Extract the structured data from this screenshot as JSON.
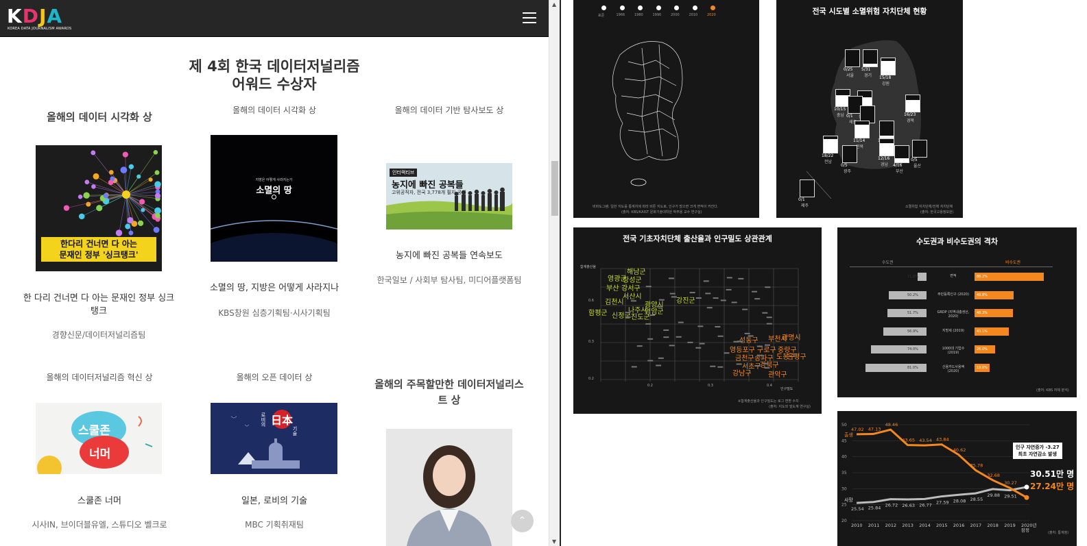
{
  "logo": {
    "letters": [
      "K",
      "D",
      "J",
      "A"
    ],
    "letter_colors": [
      "#ffffff",
      "#e8336d",
      "#f5c518",
      "#1cb5c9"
    ],
    "subtitle": "KOREA DATA JOURNALISM AWARDS"
  },
  "page": {
    "heading_line1": "제 4회 한국 데이터저널리즘",
    "heading_line2": "어워드 수상자"
  },
  "awards": [
    {
      "category": "올해의 데이터 시각화 상",
      "title": "한 다리 건너면 다 아는 문재인 정부 싱크탱크",
      "org": "경향신문/데이터저널리즘팀",
      "thumb_text_1": "한다리 건너면 다 아는",
      "thumb_text_2": "문재인 정부 '싱크탱크'"
    },
    {
      "category": "올해의 데이터 시각화 상",
      "title": "소멸의 땅, 지방은 어떻게 사라지나",
      "org": "KBS창원 심층기획팀·시사기획팀",
      "thumb_text_1": "지방은 어떻게 사라지는가",
      "thumb_text_2": "소멸의 땅"
    },
    {
      "category": "올해의 데이터 기반 탐사보도 상",
      "title": "농지에 빠진 공복들 연속보도",
      "org": "한국일보 / 사회부 탐사팀, 미디어플랫폼팀",
      "thumb_text_1": "인터랙티브",
      "thumb_text_2": "농지에 빠진 공복들",
      "thumb_text_3": "고위공직자, 전국 3,778개 필지 공개"
    },
    {
      "category": "올해의 데이터저널리즘 혁신 상",
      "title": "스쿨존 너머",
      "org": "시사IN, 브이더블유엘, 스튜디오 벨크로",
      "thumb_text_1": "스쿨존",
      "thumb_text_2": "너머"
    },
    {
      "category": "올해의 오픈 데이터 상",
      "title": "일본, 로비의 기술",
      "org": "MBC 기획취재팀",
      "thumb_text_1": "日本",
      "thumb_text_2": "로비의",
      "thumb_text_3": "기술"
    },
    {
      "category": "올해의 주목할만한 데이터저널리스트 상"
    }
  ],
  "controls": {
    "back_to_top": "⌃",
    "scroll_up": "▲",
    "scroll_down": "▼"
  },
  "panels": {
    "timeline": {
      "years": [
        "표준",
        "1966",
        "1980",
        "1990",
        "2000",
        "2010",
        "2020"
      ],
      "selected": "2020",
      "note": "비바도그램: 일반 지도를 통계치에 따라 비튼 지도로, 인구가 많으면 크게 면적이 커진다.",
      "source": "(출처: KBS/KAIST 문화기술대학원 박주용 교수 연구실)"
    },
    "regions": {
      "title": "전국 시도별 소멸위험 자치단체 현황",
      "items": [
        {
          "value": "0/25",
          "name": "서울"
        },
        {
          "value": "5/31",
          "name": "경기"
        },
        {
          "value": "15/18",
          "name": "강원"
        },
        {
          "value": "10/15",
          "name": "충남"
        },
        {
          "value": "7/11",
          "name": "충북"
        },
        {
          "value": "0/1",
          "name": "세종"
        },
        {
          "value": "0/5",
          "name": "대전"
        },
        {
          "value": "16/23",
          "name": "경북"
        },
        {
          "value": "11/14",
          "name": "전북"
        },
        {
          "value": "1/8",
          "name": "대구"
        },
        {
          "value": "18/22",
          "name": "전남"
        },
        {
          "value": "0/5",
          "name": "광주"
        },
        {
          "value": "12/16",
          "name": "경남"
        },
        {
          "value": "4/16",
          "name": "부산"
        },
        {
          "value": "0/5",
          "name": "울산"
        },
        {
          "value": "0/1",
          "name": "제주"
        }
      ],
      "note": "소멸위험 자치단체/전체 자치단체",
      "source": "(출처: 한국고용정보원)"
    },
    "scatter": {
      "title": "전국 기초자치단체 출산율과 인구밀도 상관관계",
      "ylabel": "합계출산율",
      "xlabel": "인구밀도",
      "y_ticks": [
        "0.6",
        "0.3",
        "0.2"
      ],
      "x_ticks": [
        "0.2",
        "0.3",
        "0.4"
      ],
      "green_labels": [
        "해남군",
        "영광군",
        "장성군",
        "부산",
        "강서구",
        "서산시",
        "강진군",
        "김천시",
        "광양시",
        "나주시",
        "영암군",
        "함평군",
        "신정군",
        "진도군"
      ],
      "orange_labels": [
        "성동구",
        "부천시",
        "광명시",
        "영등포구",
        "구로구",
        "중랑구",
        "금천구",
        "송파구",
        "도봉구",
        "은평구",
        "강북구",
        "관악구",
        "서초구",
        "강남구"
      ],
      "note": "※합계출산율과 인구밀도는 로그 변환 수치",
      "source": "(출처: 지도와 밀도계 연구실)"
    },
    "gap": {
      "title": "수도권과 비수도권의 격차",
      "left_header": "수도권",
      "right_header": "비수도권",
      "rows": [
        {
          "label": "면적",
          "left": "11.8%",
          "right": "88.2%",
          "left_val": 11.8,
          "right_val": 88.2
        },
        {
          "label": "주민등록인구 (2020)",
          "left": "50.2%",
          "right": "49.8%",
          "left_val": 50.2,
          "right_val": 49.8
        },
        {
          "label": "GRDP (지역내총생산, 2020)",
          "left": "51.7%",
          "right": "48.3%",
          "left_val": 51.7,
          "right_val": 48.3
        },
        {
          "label": "지방세 (2019)",
          "left": "56.9%",
          "right": "43.1%",
          "left_val": 56.9,
          "right_val": 43.1
        },
        {
          "label": "1000대 기업수 (2019)",
          "left": "74.0%",
          "right": "26.0%",
          "left_val": 74.0,
          "right_val": 26.0
        },
        {
          "label": "신용카드사용액 (2020)",
          "left": "81.0%",
          "right": "19.0%",
          "left_val": 81.0,
          "right_val": 19.0
        }
      ],
      "source": "(출처: KBS 자체 분석)"
    },
    "trend": {
      "years": [
        "2010",
        "2011",
        "2012",
        "2013",
        "2014",
        "2015",
        "2016",
        "2017",
        "2018",
        "2019",
        "2020년\n잠정"
      ],
      "y_ticks": [
        "50",
        "45",
        "40",
        "35",
        "30",
        "25",
        "20"
      ],
      "series_birth_name": "출생",
      "series_death_name": "사망",
      "birth": [
        47.02,
        47.13,
        48.46,
        43.65,
        43.54,
        43.84,
        40.62,
        35.78,
        32.68,
        30.27,
        27.24
      ],
      "death": [
        25.54,
        25.84,
        26.72,
        26.63,
        26.77,
        27.59,
        28.08,
        28.55,
        29.88,
        29.51,
        30.51
      ],
      "birth_labels": [
        "47.02",
        "47.13",
        "48.46",
        "43.65",
        "43.54",
        "43.84",
        "40.62",
        "35.78",
        "32.68",
        "30.27"
      ],
      "death_labels": [
        "25.54",
        "25.84",
        "26.72",
        "26.63",
        "26.77",
        "27.59",
        "28.08",
        "28.55",
        "29.88",
        "29.51"
      ],
      "final_death": "30.51만 명",
      "final_birth": "27.24만 명",
      "callout_1": "인구 자연증가 -3.27",
      "callout_2": "최초 자연감소 발생",
      "source": "(출처: 통계청)",
      "colors": {
        "birth": "#f5871f",
        "death": "#bdbdbd"
      }
    }
  }
}
